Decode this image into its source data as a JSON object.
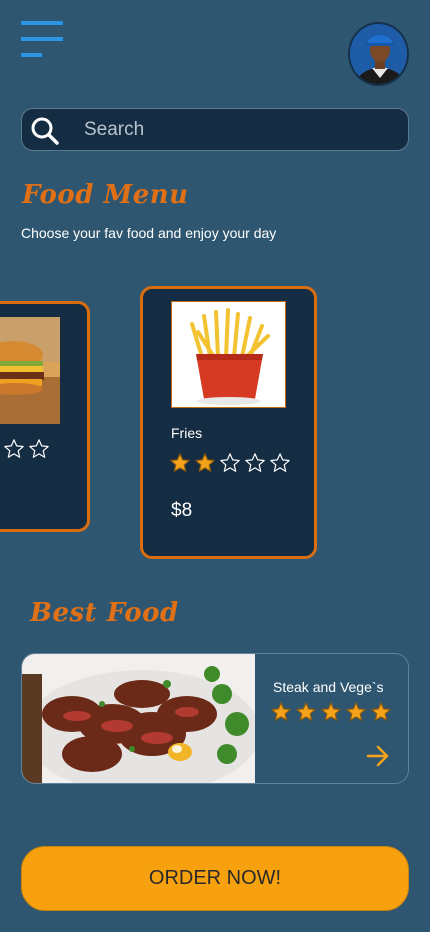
{
  "header": {
    "menu_icon": "hamburger-menu-icon",
    "avatar_icon": "user-avatar"
  },
  "search": {
    "placeholder": "Search",
    "value": "",
    "icon": "search-icon"
  },
  "food_menu": {
    "title": "Food Menu",
    "subtitle": "Choose your fav food and enjoy your day",
    "cards": [
      {
        "name": "",
        "image": "burger-image",
        "rating": 3,
        "max_rating": 5,
        "price": ""
      },
      {
        "name": "Fries",
        "image": "fries-image",
        "rating": 2,
        "max_rating": 5,
        "price": "$8"
      }
    ]
  },
  "best_food": {
    "title": "Best Food",
    "item": {
      "name": "Steak and Vege`s",
      "image": "steak-image",
      "rating": 5,
      "max_rating": 5,
      "arrow_icon": "arrow-right-icon"
    }
  },
  "order_button": {
    "label": "ORDER NOW!"
  },
  "colors": {
    "background": "#2e5670",
    "card": "#142d42",
    "accent": "#e07015",
    "star": "#f5a31a",
    "button": "#f8a10f",
    "menu_icon": "#2b95e6"
  }
}
